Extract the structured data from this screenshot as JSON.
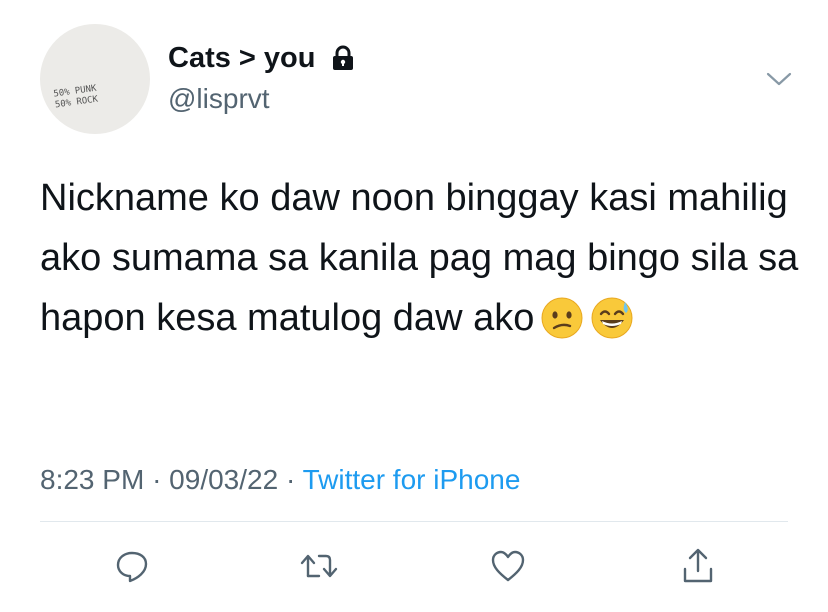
{
  "author": {
    "name": "Cats > you",
    "handle": "@lisprvt",
    "avatar_text": "50% PUNK\n50% ROCK"
  },
  "tweet": {
    "text": "Nickname ko daw noon binggay kasi mahilig ako sumama sa kanila pag mag bingo sila sa hapon kesa matulog daw ako"
  },
  "meta": {
    "time": "8:23 PM",
    "separator": "·",
    "date": "09/03/22",
    "source": "Twitter for iPhone"
  },
  "icons": {
    "lock": "lock-icon",
    "chevron": "chevron-down-icon",
    "reply": "reply-icon",
    "retweet": "retweet-icon",
    "like": "heart-icon",
    "share": "share-icon",
    "emoji1": "confused-face-emoji",
    "emoji2": "grinning-sweat-emoji"
  },
  "colors": {
    "text": "#0f1419",
    "secondary": "#536471",
    "link": "#1d9bf0",
    "divider": "#e1e8ed"
  }
}
